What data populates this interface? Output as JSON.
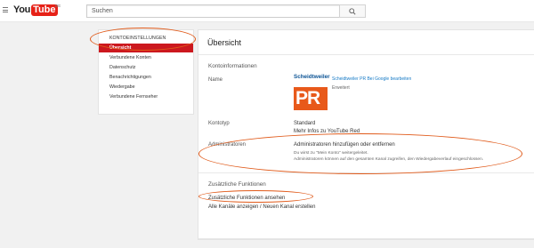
{
  "header": {
    "logo_you": "You",
    "logo_tube": "Tube",
    "logo_region": "DE",
    "search_placeholder": "Suchen"
  },
  "sidebar": {
    "heading": "KONTOEINSTELLUNGEN",
    "items": [
      {
        "label": "Übersicht",
        "active": true
      },
      {
        "label": "Verbundene Konten"
      },
      {
        "label": "Datenschutz"
      },
      {
        "label": "Benachrichtigungen"
      },
      {
        "label": "Wiedergabe"
      },
      {
        "label": "Verbundene Fernseher"
      }
    ]
  },
  "main": {
    "title": "Übersicht",
    "account_info": {
      "heading": "Kontoinformationen",
      "name_label": "Name",
      "channel_word": "Scheidtweiler",
      "channel_initials": "PR",
      "channel_name": "Scheidtweiler PR",
      "edit_link": "Bei Google bearbeiten",
      "advanced_link": "Erweitert"
    },
    "account_type": {
      "label": "Kontotyp",
      "value": "Standard",
      "more_link": "Mehr Infos zu YouTube Red"
    },
    "admins": {
      "label": "Administratoren",
      "link": "Administratoren hinzufügen oder entfernen",
      "note1": "Du wirst zu \"Mein Konto\" weitergeleitet.",
      "note2": "Administratoren können auf den gesamten Kanal zugreifen, den Wiedergabeverlauf eingeschlossen."
    },
    "extra": {
      "heading": "Zusätzliche Funktionen",
      "link1": "Zusätzliche Funktionen ansehen",
      "link2": "Alle Kanäle anzeigen / Neuen Kanal erstellen"
    }
  },
  "colors": {
    "accent": "#cc181e",
    "link": "#167ac6",
    "annotation": "#e05a1a",
    "channel_tile": "#e8591a"
  }
}
